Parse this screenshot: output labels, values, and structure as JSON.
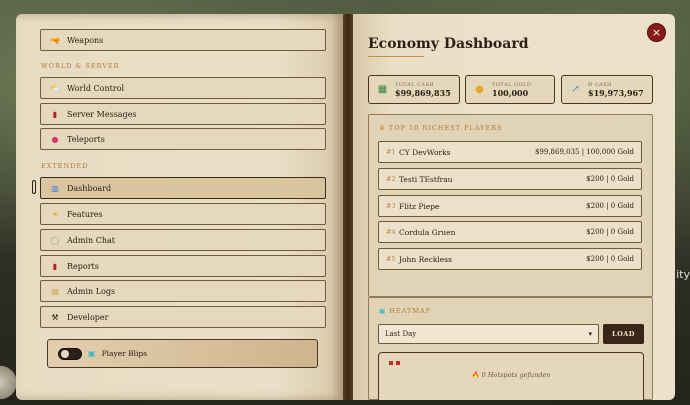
{
  "left": {
    "top_item": {
      "icon": "weapons-icon",
      "label": "Weapons"
    },
    "section_world": "WORLD & SERVER",
    "world_items": [
      {
        "icon": "world-control-icon",
        "label": "World Control"
      },
      {
        "icon": "server-messages-icon",
        "label": "Server Messages"
      },
      {
        "icon": "teleports-icon",
        "label": "Teleports"
      }
    ],
    "section_extended": "EXTENDED",
    "extended_items": [
      {
        "icon": "dashboard-icon",
        "label": "Dashboard"
      },
      {
        "icon": "features-icon",
        "label": "Features"
      },
      {
        "icon": "admin-chat-icon",
        "label": "Admin Chat"
      },
      {
        "icon": "reports-icon",
        "label": "Reports"
      },
      {
        "icon": "admin-logs-icon",
        "label": "Admin Logs"
      },
      {
        "icon": "developer-icon",
        "label": "Developer"
      }
    ],
    "blips_label": "Player Blips"
  },
  "right": {
    "title": "Economy Dashboard",
    "close_label": "×",
    "stats": [
      {
        "label": "TOTAL CASH",
        "value": "$99,869,835",
        "icon": "cash-icon"
      },
      {
        "label": "TOTAL GOLD",
        "value": "100,000",
        "icon": "gold-icon"
      },
      {
        "label": "Ø CASH",
        "value": "$19,973,967",
        "icon": "chart-icon"
      }
    ],
    "richest_title": "TOP 10 RICHEST PLAYERS",
    "players": [
      {
        "rank": "#1",
        "name": "CY DevWorks",
        "value": "$99,869,035 | 100,000 Gold"
      },
      {
        "rank": "#2",
        "name": "Testi TEstfrau",
        "value": "$200 | 0 Gold"
      },
      {
        "rank": "#3",
        "name": "Flitz Piepe",
        "value": "$200 | 0 Gold"
      },
      {
        "rank": "#4",
        "name": "Cordula Gruen",
        "value": "$200 | 0 Gold"
      },
      {
        "rank": "#5",
        "name": "John Reckless",
        "value": "$200 | 0 Gold"
      }
    ],
    "heatmap_title": "HEATMAP",
    "range_value": "Last Day",
    "load_label": "LOAD",
    "heat_legend": "",
    "hotspots_text": "0 Hotspots gefunden"
  },
  "edge_text": "ity",
  "colors": {
    "accent": "#b07a3c",
    "close": "#8a1b1b",
    "load": "#3a2616"
  }
}
